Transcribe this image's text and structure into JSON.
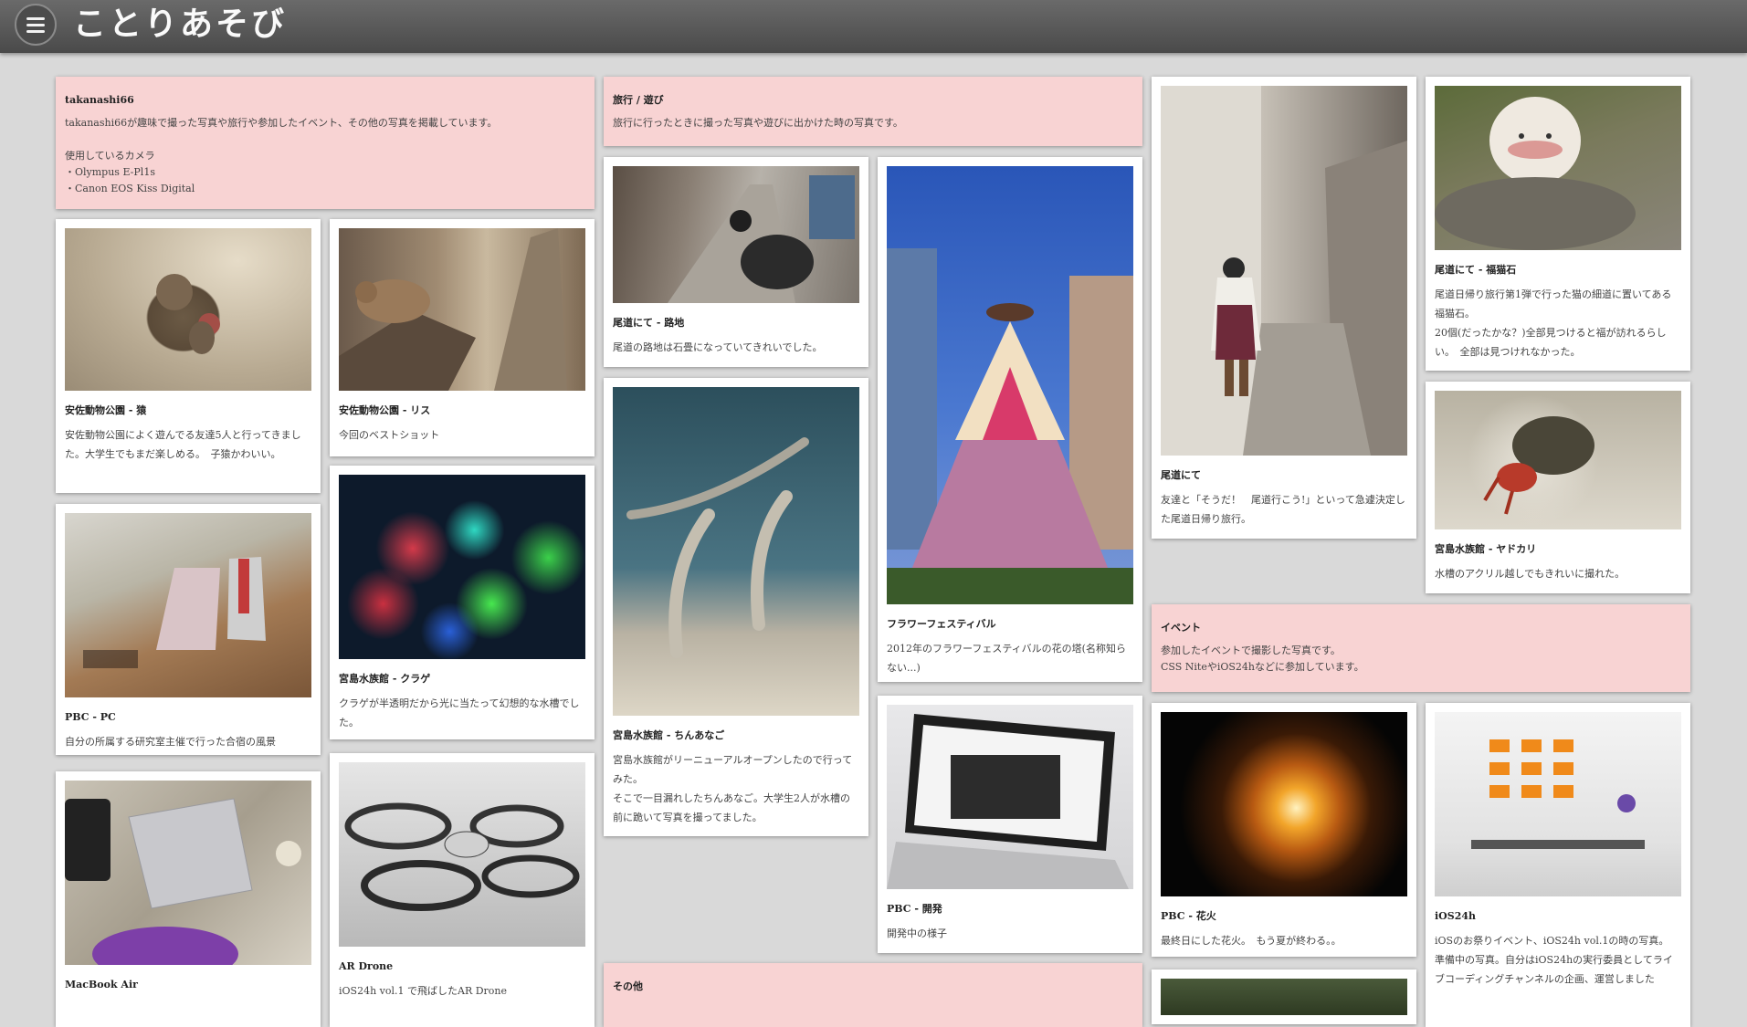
{
  "site_title": "ことりあそび",
  "menu_icon": "hamburger-menu-icon",
  "colors": {
    "header": "#555555",
    "category_card": "#f8d3d3",
    "background": "#d9d9d9"
  },
  "intro": {
    "title": "takanashi66",
    "desc": "takanashi66が趣味で撮った写真や旅行や参加したイベント、その他の写真を掲載しています。\n\n使用しているカメラ\n・Olympus E-Pl1s\n・Canon EOS Kiss Digital"
  },
  "categories": {
    "travel": {
      "title": "旅行 / 遊び",
      "desc": "旅行に行ったときに撮った写真や遊びに出かけた時の写真です。"
    },
    "event": {
      "title": "イベント",
      "desc": "参加したイベントで撮影した写真です。\nCSS NiteやiOS24hなどに参加しています。"
    },
    "other": {
      "title": "その他",
      "desc": ""
    }
  },
  "cards": {
    "monkey": {
      "title": "安佐動物公園 - 猿",
      "desc": "安佐動物公園によく遊んでる友達5人と行ってきました。大学生でもまだ楽しめる。　子猿かわいい。"
    },
    "squirrel": {
      "title": "安佐動物公園 - リス",
      "desc": "今回のベストショット"
    },
    "pbc_pc": {
      "title": "PBC - PC",
      "desc": "自分の所属する研究室主催で行った合宿の風景"
    },
    "jellyfish": {
      "title": "宮島水族館 - クラゲ",
      "desc": "クラゲが半透明だから光に当たって幻想的な水槽でした。"
    },
    "macbook": {
      "title": "MacBook Air",
      "desc": ""
    },
    "drone": {
      "title": "AR Drone",
      "desc": "iOS24h vol.1 で飛ばしたAR Drone"
    },
    "alley": {
      "title": "尾道にて - 路地",
      "desc": "尾道の路地は石畳になっていてきれいでした。"
    },
    "eels": {
      "title": "宮島水族館 - ちんあなご",
      "desc": "宮島水族館がリーニューアルオープンしたので行ってみた。\nそこで一目漏れしたちんあなご。大学生2人が水槽の前に跪いて写真を撮ってました。"
    },
    "flower": {
      "title": "フラワーフェスティバル",
      "desc": "2012年のフラワーフェスティバルの花の塔(名称知らない...)"
    },
    "pbc_dev": {
      "title": "PBC - 開発",
      "desc": "開発中の様子"
    },
    "onomichi": {
      "title": "尾道にて",
      "desc": "友達と「そうだ！　尾道行こう!」といって急遽決定した尾道日帰り旅行。"
    },
    "cat_stone": {
      "title": "尾道にて - 福猫石",
      "desc": "尾道日帰り旅行第1弾で行った猫の細道に置いてある福猫石。\n20個(だったかな？)全部見つけると福が訪れるらしい。　全部は見つけれなかった。"
    },
    "crab": {
      "title": "宮島水族館 - ヤドカリ",
      "desc": "水槽のアクリル越しでもきれいに撮れた。"
    },
    "fireworks": {
      "title": "PBC - 花火",
      "desc": "最終日にした花火。　もう夏が終わる。。"
    },
    "ios24h": {
      "title": "iOS24h",
      "desc": "iOSのお祭りイベント、iOS24h vol.1の時の写真。\n準備中の写真。自分はiOS24hの実行委員としてライブコーディングチャンネルの企画、運営しました"
    }
  }
}
